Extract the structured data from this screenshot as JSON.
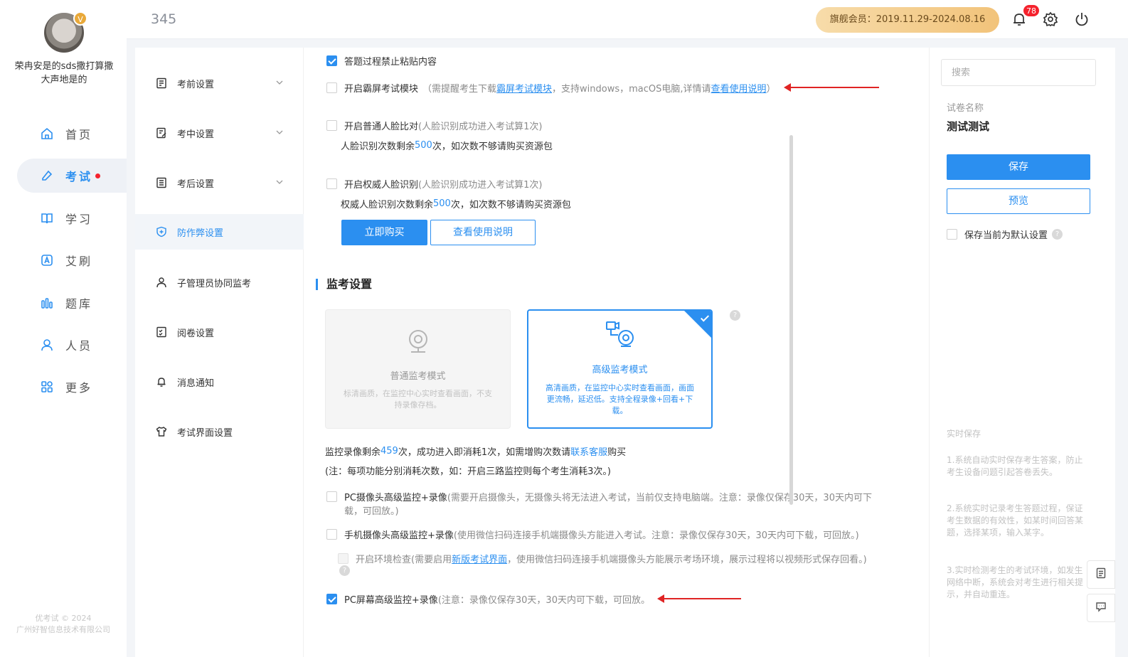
{
  "header": {
    "title": "345",
    "membership": "旗舰会员：2019.11.29-2024.08.16",
    "notification_count": "78"
  },
  "user": {
    "name": "荣冉安是的sds撒打算撒大声地是的",
    "badge": "V"
  },
  "leftnav": {
    "items": [
      {
        "label": "首页",
        "icon": "home-icon"
      },
      {
        "label": "考试",
        "icon": "exam-icon"
      },
      {
        "label": "学习",
        "icon": "book-icon"
      },
      {
        "label": "艾刷",
        "icon": "a-icon"
      },
      {
        "label": "题库",
        "icon": "bars-icon"
      },
      {
        "label": "人员",
        "icon": "user-icon"
      },
      {
        "label": "更多",
        "icon": "apps-icon"
      }
    ],
    "copyright_line1": "优考试 © 2024",
    "copyright_line2": "广州好智信息技术有限公司"
  },
  "subnav": {
    "items": [
      {
        "label": "考前设置"
      },
      {
        "label": "考中设置"
      },
      {
        "label": "考后设置"
      },
      {
        "label": "防作弊设置"
      },
      {
        "label": "子管理员协同监考"
      },
      {
        "label": "阅卷设置"
      },
      {
        "label": "消息通知"
      },
      {
        "label": "考试界面设置"
      }
    ]
  },
  "main": {
    "no_paste": "答题过程禁止粘贴内容",
    "lockdown_label": "开启霸屏考试模块",
    "lockdown_note_pre": "（需提醒考生下载",
    "lockdown_link": "霸屏考试模块",
    "lockdown_note_mid": "，支持windows，macOS电脑,详情请",
    "lockdown_help_link": "查看使用说明",
    "lockdown_note_end": "）",
    "face_label": "开启普通人脸比对",
    "face_note": "(人脸识别成功进入考试算1次)",
    "face_remain_pre": "人脸识别次数剩余",
    "face_remain_num": "500",
    "face_remain_post": "次，如次数不够请购买资源包",
    "auth_face_label": "开启权威人脸识别",
    "auth_face_note": "(人脸识别成功进入考试算1次)",
    "auth_remain_pre": "权威人脸识别次数剩余",
    "auth_remain_num": "500",
    "auth_remain_post": "次，如次数不够请购买资源包",
    "buy_button": "立即购买",
    "guide_button": "查看使用说明",
    "section_title": "监考设置",
    "mode_normal_title": "普通监考模式",
    "mode_normal_desc": "标清画质，在监控中心实时查看画面，不支持录像存档。",
    "mode_adv_title": "高级监考模式",
    "mode_adv_desc": "高清画质，在监控中心实时查看画面，画面更流畅，延迟低。支持全程录像+回看+下载。",
    "record_pre": "监控录像剩余",
    "record_num": "459",
    "record_mid": "次，成功进入即消耗1次，如需增购次数请",
    "record_link": "联系客服",
    "record_post": "购买",
    "record_note": "(注：每项功能分别消耗次数，如：开启三路监控则每个考生消耗3次。)",
    "pc_cam_label": "PC摄像头高级监控+录像",
    "pc_cam_note": "(需要开启摄像头，无摄像头将无法进入考试，当前仅支持电脑端。注意：录像仅保存30天，30天内可下",
    "pc_cam_note2": "载，可回放。)",
    "mobile_cam_label": "手机摄像头高级监控+录像",
    "mobile_cam_note": "(使用微信扫码连接手机端摄像头方能进入考试。注意：录像仅保存30天，30天内可下载，可回放。)",
    "env_check_pre": "开启环境检查(需要启用",
    "env_check_link": "新版考试界面",
    "env_check_post": "，使用微信扫码连接手机端摄像头方能展示考场环境，展示过程将以视频形式保存回看。)",
    "screen_label": "PC屏幕高级监控+录像",
    "screen_note": "(注意：录像仅保存30天，30天内可下载，可回放。"
  },
  "right": {
    "search_placeholder": "搜索",
    "paper_label": "试卷名称",
    "paper_name": "测试测试",
    "save_button": "保存",
    "preview_button": "预览",
    "default_label": "保存当前为默认设置",
    "autosave_title": "实时保存",
    "tips": [
      "1.系统自动实时保存考生答案，防止考生设备问题引起答卷丢失。",
      "2.系统实时记录考生答题过程，保证考生数据的有效性，如某时间回答某题，选择某项，输入某字。",
      "3.实时检测考生的考试环境，如发生网络中断，系统会对考生进行相关提示，并自动重连。"
    ]
  },
  "colors": {
    "accent": "#2b8ff0",
    "danger": "#e02424",
    "member_gold": "#f2c37a"
  }
}
